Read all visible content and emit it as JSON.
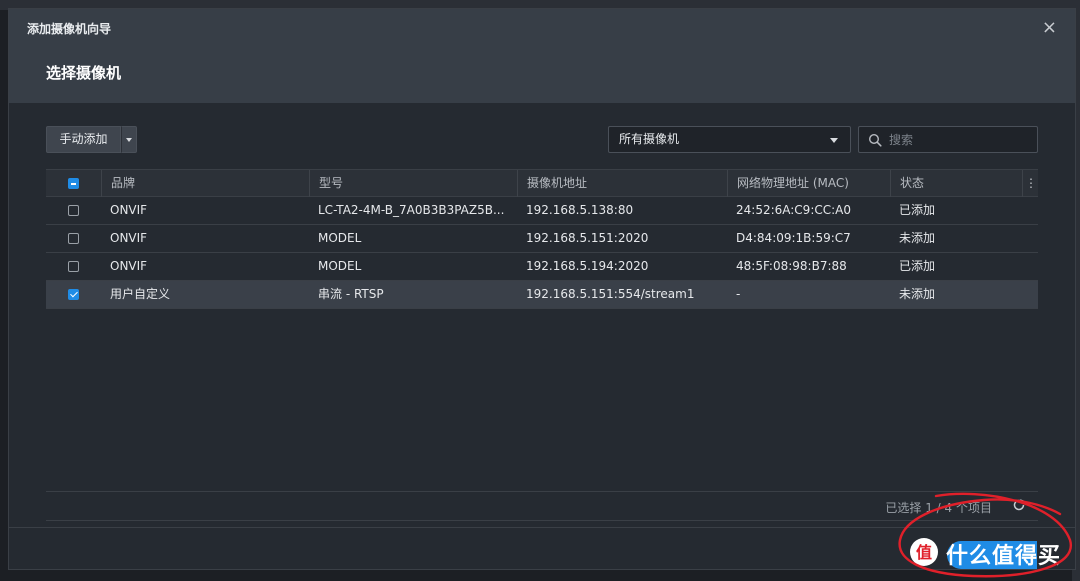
{
  "dialog": {
    "window_title": "添加摄像机向导",
    "step_title": "选择摄像机",
    "close_glyph": "×"
  },
  "toolbar": {
    "add_label": "手动添加",
    "filter_selected": "所有摄像机",
    "search_placeholder": "搜索"
  },
  "table": {
    "columns": [
      "品牌",
      "型号",
      "摄像机地址",
      "网络物理地址 (MAC)",
      "状态"
    ],
    "more_glyph": "⋮",
    "rows": [
      {
        "brand": "ONVIF",
        "model": "LC-TA2-4M-B_7A0B3B3PAZ5B...",
        "address": "192.168.5.138:80",
        "mac": "24:52:6A:C9:CC:A0",
        "status": "已添加",
        "checked": false
      },
      {
        "brand": "ONVIF",
        "model": "MODEL",
        "address": "192.168.5.151:2020",
        "mac": "D4:84:09:1B:59:C7",
        "status": "未添加",
        "checked": false
      },
      {
        "brand": "ONVIF",
        "model": "MODEL",
        "address": "192.168.5.194:2020",
        "mac": "48:5F:08:98:B7:88",
        "status": "已添加",
        "checked": false
      },
      {
        "brand": "用户自定义",
        "model": "串流 - RTSP",
        "address": "192.168.5.151:554/stream1",
        "mac": "-",
        "status": "未添加",
        "checked": true
      }
    ]
  },
  "footer": {
    "selection_status": "已选择 1 / 4 个项目"
  },
  "watermark": {
    "text": "什么值得买"
  },
  "colors": {
    "accent": "#1f8ce6",
    "annotation": "#e0202a"
  }
}
